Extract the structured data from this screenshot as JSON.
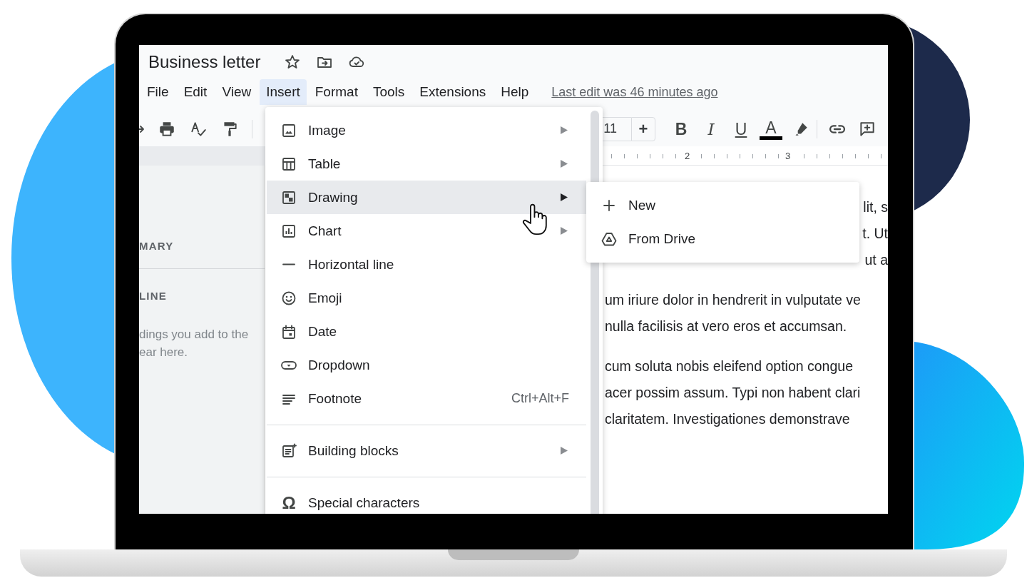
{
  "document": {
    "title": "Business letter"
  },
  "menu_bar": {
    "items": [
      {
        "label": "File",
        "selected": false
      },
      {
        "label": "Edit",
        "selected": false
      },
      {
        "label": "View",
        "selected": false
      },
      {
        "label": "Insert",
        "selected": true
      },
      {
        "label": "Format",
        "selected": false
      },
      {
        "label": "Tools",
        "selected": false
      },
      {
        "label": "Extensions",
        "selected": false
      },
      {
        "label": "Help",
        "selected": false
      }
    ],
    "last_edit": "Last edit was 46 minutes ago"
  },
  "toolbar": {
    "font_size": "11",
    "increase": "+",
    "format_buttons": [
      {
        "kind": "bold",
        "label": "B"
      },
      {
        "kind": "italic",
        "label": "I"
      },
      {
        "kind": "underline",
        "label": "U"
      },
      {
        "kind": "text_color",
        "label": "A"
      }
    ]
  },
  "ruler": {
    "labels": [
      "2",
      "3"
    ]
  },
  "sidebar": {
    "sections": [
      {
        "heading": "MARY"
      },
      {
        "heading": "LINE",
        "hint": "dings you add to the\near here."
      }
    ]
  },
  "page": {
    "paragraphs": [
      {
        "lines": [
          {
            "kind": "tail",
            "text": "lit, s"
          },
          {
            "kind": "tail",
            "text": "t. Ut"
          },
          {
            "kind": "tail",
            "text": "ut a"
          }
        ]
      },
      {
        "lines": [
          {
            "kind": "line",
            "text": "um iriure dolor in hendrerit in vulputate ve"
          },
          {
            "kind": "line",
            "text": "nulla facilisis at vero eros et accumsan."
          }
        ]
      },
      {
        "lines": [
          {
            "kind": "line",
            "text": "cum soluta nobis eleifend option congue"
          },
          {
            "kind": "line",
            "text": "acer possim assum. Typi non habent clari"
          },
          {
            "kind": "line",
            "text": "claritatem. Investigationes demonstrave"
          }
        ]
      }
    ]
  },
  "insert_menu": {
    "items": [
      {
        "kind": "image",
        "label": "Image",
        "submenu": true,
        "selected": false
      },
      {
        "kind": "table",
        "label": "Table",
        "submenu": true,
        "selected": false
      },
      {
        "kind": "drawing",
        "label": "Drawing",
        "submenu": true,
        "selected": true
      },
      {
        "kind": "chart",
        "label": "Chart",
        "submenu": true,
        "selected": false
      },
      {
        "kind": "line",
        "label": "Horizontal line",
        "submenu": false,
        "selected": false
      },
      {
        "kind": "emoji",
        "label": "Emoji",
        "submenu": false,
        "selected": false
      },
      {
        "kind": "date",
        "label": "Date",
        "submenu": false,
        "selected": false
      },
      {
        "kind": "dropdown",
        "label": "Dropdown",
        "submenu": false,
        "selected": false
      },
      {
        "kind": "footnote",
        "label": "Footnote",
        "shortcut": "Ctrl+Alt+F",
        "submenu": false,
        "selected": false
      },
      {
        "kind": "separator"
      },
      {
        "kind": "blocks",
        "label": "Building blocks",
        "submenu": true,
        "selected": false
      },
      {
        "kind": "separator"
      },
      {
        "kind": "symbol",
        "icon_char": "Ω",
        "label": "Special characters",
        "submenu": false,
        "selected": false
      }
    ]
  },
  "drawing_submenu": {
    "items": [
      {
        "kind": "new",
        "label": "New"
      },
      {
        "kind": "drive",
        "label": "From Drive"
      }
    ]
  }
}
